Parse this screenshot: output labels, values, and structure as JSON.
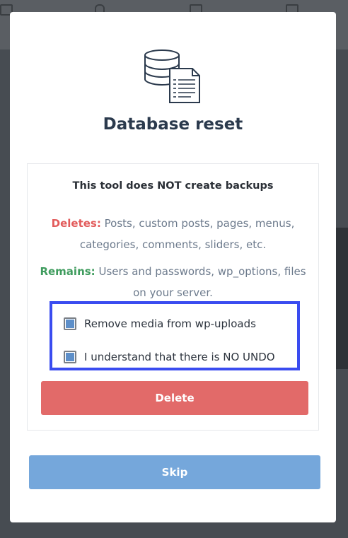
{
  "modal": {
    "title": "Database reset",
    "icon": "database-document-icon",
    "warning": "This tool does NOT create backups",
    "deletes_label": "Deletes:",
    "deletes_text": "Posts, custom posts, pages, menus, categories, comments, sliders, etc.",
    "remains_label": "Remains:",
    "remains_text": "Users and passwords, wp_options, files on your server.",
    "options": [
      {
        "label": "Remove media from wp-uploads",
        "checked": true
      },
      {
        "label": "I understand that there is NO UNDO",
        "checked": true
      }
    ],
    "delete_button": "Delete",
    "skip_button": "Skip"
  },
  "colors": {
    "title": "#2b3a4d",
    "deletes": "#e25b5b",
    "remains": "#3f9c5e",
    "highlight_border": "#3a4cf0",
    "delete_button": "#e26a69",
    "skip_button": "#75a7db",
    "checkbox_fill": "#5d8fc9"
  }
}
